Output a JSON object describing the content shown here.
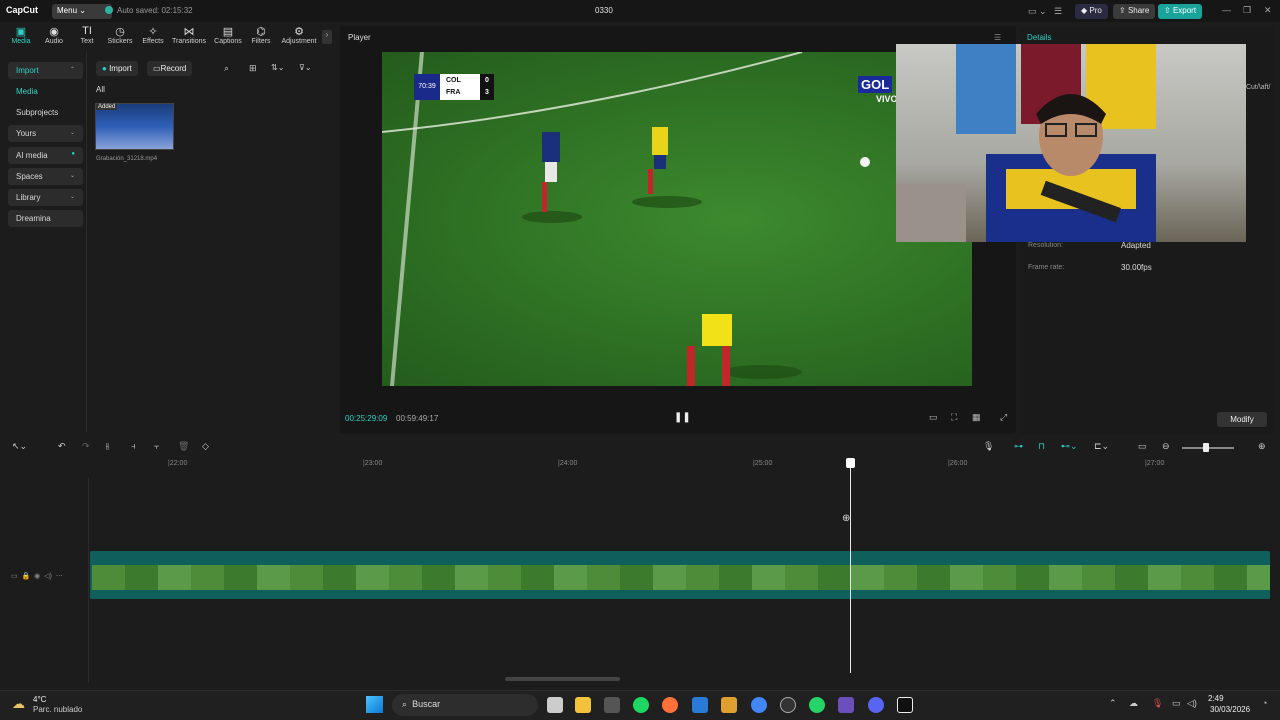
{
  "app": {
    "logo": "CapCut",
    "menu_label": "Menu",
    "autosave": "Auto saved: 02:15:32",
    "project_title": "0330"
  },
  "top_actions": {
    "pro": "Pro",
    "share": "Share",
    "export": "Export"
  },
  "toolbar": {
    "items": [
      "Media",
      "Audio",
      "Text",
      "Stickers",
      "Effects",
      "Transitions",
      "Captions",
      "Filters",
      "Adjustment"
    ]
  },
  "sidebar": {
    "items": [
      "Import",
      "Media",
      "Subprojects",
      "Yours",
      "AI media",
      "Spaces",
      "Library",
      "Dreamina"
    ]
  },
  "media_panel": {
    "import_btn": "Import",
    "record_btn": "Record",
    "filter_all": "All",
    "clip_badge": "Added",
    "clip_name": "Grabación_31218.mp4"
  },
  "player": {
    "label": "Player",
    "current_time": "00:25:29:09",
    "total_time": "00:59:49:17"
  },
  "video": {
    "score_time": "70:39",
    "team1": "COL",
    "score1": "0",
    "team2": "FRA",
    "score2": "3",
    "overlay_text1": "GOL",
    "overlay_text2": "VIVO"
  },
  "details": {
    "tab": "Details",
    "resolution_label": "Resolution:",
    "resolution_value": "Adapted",
    "framerate_label": "Frame rate:",
    "framerate_value": "30.00fps",
    "path_text": "\\Cut/\\aft/",
    "modify": "Modify"
  },
  "timeline": {
    "ticks": [
      "|22:00",
      "|23:00",
      "|24:00",
      "|25:00",
      "|26:00",
      "|27:00"
    ]
  },
  "taskbar": {
    "weather_temp": "4°C",
    "weather_desc": "Parc. nublado",
    "search": "Buscar",
    "time": "2:49",
    "date": "30/03/2026"
  }
}
